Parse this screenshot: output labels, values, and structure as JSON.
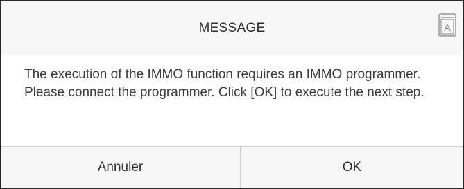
{
  "dialog": {
    "title": "MESSAGE",
    "message": "The execution of the IMMO function requires an IMMO programmer. Please connect the programmer. Click [OK] to execute the next step.",
    "cancel_label": "Annuler",
    "ok_label": "OK",
    "corner_icon": "font-size-icon",
    "corner_icon_letter": "A"
  },
  "colors": {
    "header_bg": "#f7f7f7",
    "footer_bg": "#f7f7f7",
    "divider": "#cfcfcf",
    "text": "#3a3a3a",
    "border": "#2a2a2a"
  }
}
